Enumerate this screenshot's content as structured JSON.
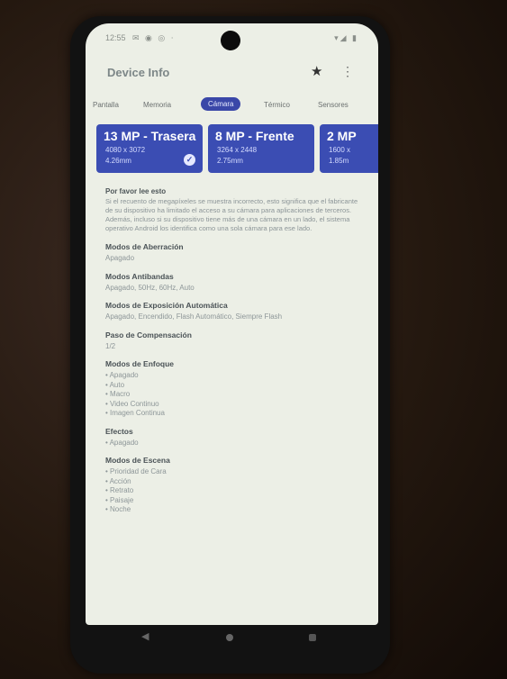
{
  "status_bar": {
    "time": "12:55",
    "icons_left": "✉ ◉ ◎ ⋅",
    "icons_right": "▾◢ ▮"
  },
  "app_bar": {
    "title": "Device Info",
    "star_icon": "★",
    "more_icon": "⋮"
  },
  "tabs": [
    "Pantalla",
    "Memoria",
    "Cámara",
    "Térmico",
    "Sensores"
  ],
  "active_tab": "Cámara",
  "cameras": [
    {
      "title": "13 MP - Trasera",
      "resolution": "4080 x 3072",
      "pixel_size": "4.26mm",
      "selected": true
    },
    {
      "title": "8 MP - Frente",
      "resolution": "3264 x 2448",
      "pixel_size": "2.75mm",
      "selected": false
    },
    {
      "title": "2 MP",
      "resolution": "1600 x",
      "pixel_size": "1.85m",
      "selected": false
    }
  ],
  "note": {
    "title": "Por favor lee esto",
    "body": "Si el recuento de megapíxeles se muestra incorrecto, esto significa que el fabricante de su dispositivo ha limitado el acceso a su cámara para aplicaciones de terceros. Además, incluso si su dispositivo tiene más de una cámara en un lado, el sistema operativo Android los identifica como una sola cámara para ese lado."
  },
  "sections": [
    {
      "title": "Modos de Aberración",
      "value": "Apagado"
    },
    {
      "title": "Modos Antibandas",
      "value": "Apagado, 50Hz, 60Hz, Auto"
    },
    {
      "title": "Modos de Exposición Automática",
      "value": "Apagado, Encendido, Flash Automático, Siempre Flash"
    },
    {
      "title": "Paso de Compensación",
      "value": "1/2"
    },
    {
      "title": "Modos de Enfoque",
      "value": "• Apagado\n• Auto\n• Macro\n• Video Continuo\n• Imagen Continua"
    },
    {
      "title": "Efectos",
      "value": "• Apagado"
    },
    {
      "title": "Modos de Escena",
      "value": "• Prioridad de Cara\n• Acción\n• Retrato\n• Paisaje\n• Noche"
    }
  ],
  "nav": {
    "back_icon": "◀"
  },
  "colors": {
    "accent": "#3b4db3",
    "screen_bg": "#ecefe6"
  }
}
